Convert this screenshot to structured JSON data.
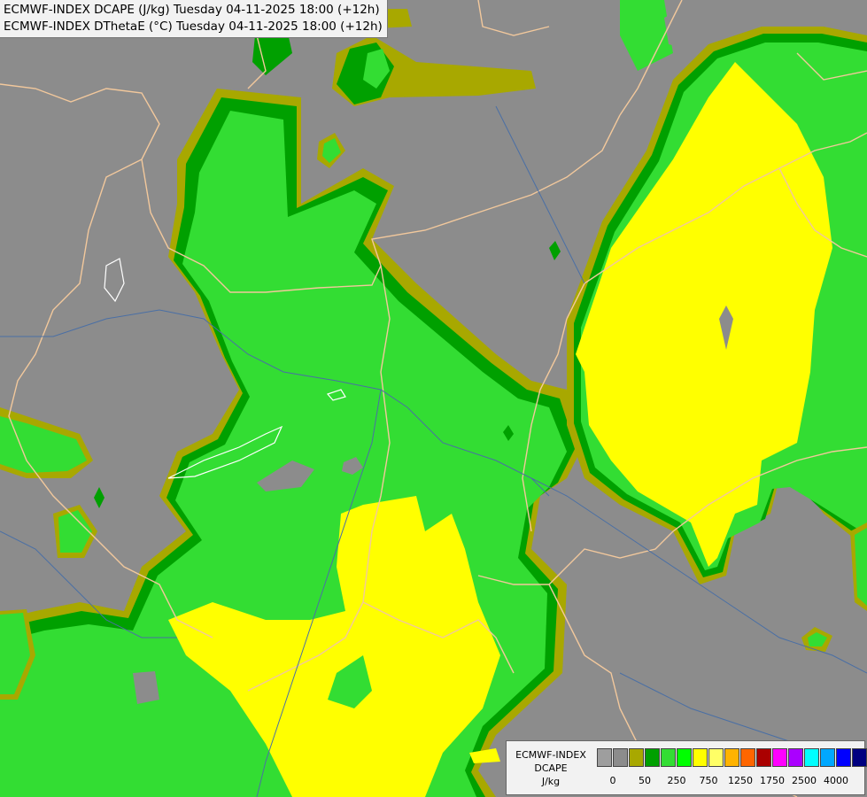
{
  "header": {
    "line1": "ECMWF-INDEX DCAPE (J/kg) Tuesday 04-11-2025 18:00 (+12h)",
    "line2": "ECMWF-INDEX DThetaE (°C) Tuesday 04-11-2025 18:00 (+12h)"
  },
  "legend": {
    "title_line1": "ECMWF-INDEX",
    "title_line2": "DCAPE",
    "title_line3": "J/kg",
    "swatches": [
      "#9e9e9e",
      "#8c8c8c",
      "#a8a800",
      "#00a000",
      "#33dd33",
      "#00ff00",
      "#ffff00",
      "#ffff66",
      "#ffb300",
      "#ff6600",
      "#aa0000",
      "#ff00ff",
      "#aa00ff",
      "#00ffff",
      "#00a8ff",
      "#0000ff",
      "#000080"
    ],
    "ticks": [
      "0",
      "50",
      "250",
      "750",
      "1250",
      "1750",
      "2500",
      "4000"
    ]
  },
  "colors": {
    "background": "#8c8c8c",
    "olive": "#a8a800",
    "dark_green": "#00a000",
    "green": "#33dd33",
    "yellow": "#ffff00",
    "borders": "#f2c89c",
    "rivers": "#4a6fa5",
    "lakes": "#ffffff"
  }
}
